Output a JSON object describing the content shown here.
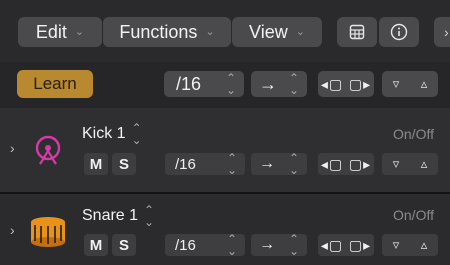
{
  "menubar": {
    "edit": "Edit",
    "functions": "Functions",
    "view": "View"
  },
  "controls": {
    "learn": "Learn",
    "resolution": "/16",
    "arrow": "→",
    "left_nudge": "◂▢",
    "right_nudge": "▢▸",
    "down": "⌄",
    "up": "⌃",
    "updown": "⌃⌄"
  },
  "tracks": [
    {
      "name": "Kick 1",
      "on_off": "On/Off",
      "mute": "M",
      "solo": "S",
      "resolution": "/16"
    },
    {
      "name": "Snare 1",
      "on_off": "On/Off",
      "mute": "M",
      "solo": "S",
      "resolution": "/16"
    }
  ],
  "colors": {
    "accent_learn": "#b8892e",
    "kick_icon": "#d63aa8",
    "snare_icon": "#e8921a"
  },
  "icons": {
    "grid": "grid-icon",
    "info": "info-icon",
    "more": "more-icon"
  }
}
